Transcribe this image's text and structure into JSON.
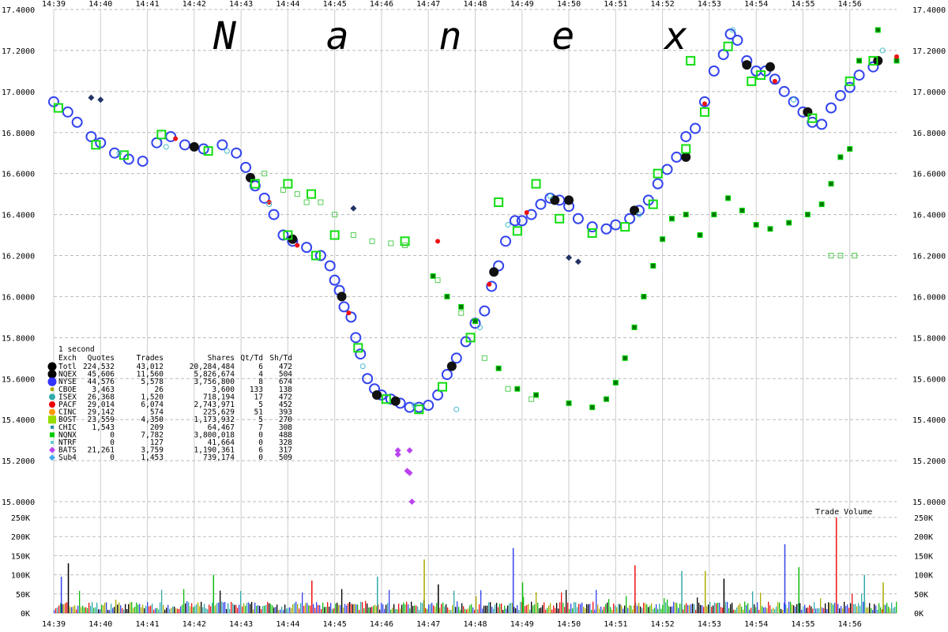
{
  "chart_data": {
    "type": "scatter",
    "watermark": "N a n e x",
    "x_ticks": [
      "14:39",
      "14:40",
      "14:41",
      "14:42",
      "14:43",
      "14:44",
      "14:45",
      "14:46",
      "14:47",
      "14:48",
      "14:49",
      "14:50",
      "14:51",
      "14:52",
      "14:53",
      "14:54",
      "14:55",
      "14:56"
    ],
    "x_range_minutes": [
      0,
      18
    ],
    "y_ticks": [
      "15.0000",
      "15.2000",
      "15.4000",
      "15.6000",
      "15.8000",
      "16.0000",
      "16.2000",
      "16.4000",
      "16.6000",
      "16.8000",
      "17.0000",
      "17.2000",
      "17.4000"
    ],
    "ylim": [
      15.0,
      17.4
    ],
    "volume_ticks": [
      "0K",
      "50K",
      "100K",
      "150K",
      "200K",
      "250K"
    ],
    "volume_ylim": [
      0,
      250000
    ],
    "volume_label": "Trade Volume",
    "grid": true,
    "stats": {
      "interval": "1 second",
      "headers": [
        "Exch",
        "Quotes",
        "Trades",
        "Shares",
        "Qt/Td",
        "Sh/Td"
      ],
      "rows": [
        {
          "exch": "Totl",
          "quotes": "224,532",
          "trades": "43,012",
          "shares": "20,284,484",
          "qt_td": "6",
          "sh_td": "472",
          "color": "#000000",
          "marker": "circle-large"
        },
        {
          "exch": "NQEX",
          "quotes": "45,606",
          "trades": "11,560",
          "shares": "5,826,674",
          "qt_td": "4",
          "sh_td": "504",
          "color": "#000000",
          "marker": "circle-large"
        },
        {
          "exch": "NYSE",
          "quotes": "44,576",
          "trades": "5,578",
          "shares": "3,756,800",
          "qt_td": "8",
          "sh_td": "674",
          "color": "#3333ff",
          "marker": "circle-large"
        },
        {
          "exch": "CBOE",
          "quotes": "3,463",
          "trades": "26",
          "shares": "3,600",
          "qt_td": "133",
          "sh_td": "138",
          "color": "#aaaa00",
          "marker": "circle-small"
        },
        {
          "exch": "ISEX",
          "quotes": "26,368",
          "trades": "1,520",
          "shares": "718,194",
          "qt_td": "17",
          "sh_td": "472",
          "color": "#33aaaa",
          "marker": "circle"
        },
        {
          "exch": "PACF",
          "quotes": "29,014",
          "trades": "6,074",
          "shares": "2,743,971",
          "qt_td": "5",
          "sh_td": "452",
          "color": "#ee0000",
          "marker": "circle"
        },
        {
          "exch": "CINC",
          "quotes": "29,142",
          "trades": "574",
          "shares": "225,629",
          "qt_td": "51",
          "sh_td": "393",
          "color": "#ff9900",
          "marker": "circle"
        },
        {
          "exch": "BOST",
          "quotes": "23,559",
          "trades": "4,350",
          "shares": "1,173,932",
          "qt_td": "5",
          "sh_td": "270",
          "color": "#99dd00",
          "marker": "square-large"
        },
        {
          "exch": "CHIC",
          "quotes": "1,543",
          "trades": "209",
          "shares": "64,467",
          "qt_td": "7",
          "sh_td": "308",
          "color": "#2288aa",
          "marker": "square-small"
        },
        {
          "exch": "NQNX",
          "quotes": "0",
          "trades": "7,782",
          "shares": "3,800,018",
          "qt_td": "0",
          "sh_td": "488",
          "color": "#00cc00",
          "marker": "square"
        },
        {
          "exch": "NTRF",
          "quotes": "0",
          "trades": "127",
          "shares": "41,664",
          "qt_td": "0",
          "sh_td": "328",
          "color": "#66cccc",
          "marker": "square-small"
        },
        {
          "exch": "BATS",
          "quotes": "21,261",
          "trades": "3,759",
          "shares": "1,190,361",
          "qt_td": "6",
          "sh_td": "317",
          "color": "#bb44ee",
          "marker": "diamond"
        },
        {
          "exch": "Sub4",
          "quotes": "0",
          "trades": "1,453",
          "shares": "739,174",
          "qt_td": "0",
          "sh_td": "509",
          "color": "#44aaee",
          "marker": "diamond"
        }
      ]
    },
    "series": [
      {
        "color": "#3344ee",
        "marker": "circle",
        "points": [
          [
            0.0,
            16.95
          ],
          [
            0.3,
            16.9
          ],
          [
            0.5,
            16.85
          ],
          [
            0.8,
            16.78
          ],
          [
            1.0,
            16.75
          ],
          [
            1.3,
            16.7
          ],
          [
            1.6,
            16.67
          ],
          [
            1.9,
            16.66
          ],
          [
            2.2,
            16.75
          ],
          [
            2.5,
            16.78
          ],
          [
            2.8,
            16.74
          ],
          [
            3.2,
            16.72
          ],
          [
            3.6,
            16.74
          ],
          [
            3.9,
            16.7
          ],
          [
            4.1,
            16.63
          ],
          [
            4.3,
            16.54
          ],
          [
            4.5,
            16.48
          ],
          [
            4.7,
            16.4
          ],
          [
            4.9,
            16.3
          ],
          [
            5.1,
            16.27
          ],
          [
            5.4,
            16.24
          ],
          [
            5.7,
            16.2
          ],
          [
            5.9,
            16.15
          ],
          [
            6.0,
            16.08
          ],
          [
            6.1,
            16.03
          ],
          [
            6.2,
            15.95
          ],
          [
            6.35,
            15.9
          ],
          [
            6.45,
            15.8
          ],
          [
            6.55,
            15.72
          ],
          [
            6.7,
            15.6
          ],
          [
            6.85,
            15.55
          ],
          [
            7.0,
            15.52
          ],
          [
            7.2,
            15.5
          ],
          [
            7.4,
            15.48
          ],
          [
            7.6,
            15.46
          ],
          [
            7.8,
            15.46
          ],
          [
            8.0,
            15.47
          ],
          [
            8.2,
            15.52
          ],
          [
            8.4,
            15.62
          ],
          [
            8.6,
            15.7
          ],
          [
            8.8,
            15.78
          ],
          [
            9.0,
            15.87
          ],
          [
            9.2,
            15.93
          ],
          [
            9.35,
            16.05
          ],
          [
            9.5,
            16.15
          ],
          [
            9.65,
            16.27
          ],
          [
            9.85,
            16.37
          ],
          [
            10.0,
            16.37
          ],
          [
            10.2,
            16.4
          ],
          [
            10.4,
            16.45
          ],
          [
            10.6,
            16.48
          ],
          [
            10.8,
            16.47
          ],
          [
            11.0,
            16.44
          ],
          [
            11.2,
            16.38
          ],
          [
            11.5,
            16.34
          ],
          [
            11.8,
            16.33
          ],
          [
            12.0,
            16.35
          ],
          [
            12.3,
            16.38
          ],
          [
            12.5,
            16.42
          ],
          [
            12.7,
            16.47
          ],
          [
            12.9,
            16.55
          ],
          [
            13.1,
            16.62
          ],
          [
            13.3,
            16.68
          ],
          [
            13.5,
            16.78
          ],
          [
            13.7,
            16.82
          ],
          [
            13.9,
            16.95
          ],
          [
            14.1,
            17.1
          ],
          [
            14.3,
            17.18
          ],
          [
            14.45,
            17.28
          ],
          [
            14.6,
            17.25
          ],
          [
            14.8,
            17.15
          ],
          [
            15.0,
            17.1
          ],
          [
            15.2,
            17.1
          ],
          [
            15.4,
            17.06
          ],
          [
            15.6,
            17.0
          ],
          [
            15.8,
            16.95
          ],
          [
            16.0,
            16.9
          ],
          [
            16.2,
            16.85
          ],
          [
            16.4,
            16.84
          ],
          [
            16.6,
            16.92
          ],
          [
            16.8,
            16.98
          ],
          [
            17.0,
            17.02
          ],
          [
            17.2,
            17.08
          ],
          [
            17.5,
            17.12
          ]
        ]
      },
      {
        "color": "#111111",
        "marker": "circle-filled",
        "points": [
          [
            3.0,
            16.73
          ],
          [
            4.2,
            16.58
          ],
          [
            5.1,
            16.28
          ],
          [
            6.15,
            16.0
          ],
          [
            6.9,
            15.52
          ],
          [
            7.3,
            15.49
          ],
          [
            8.5,
            15.66
          ],
          [
            9.4,
            16.12
          ],
          [
            10.7,
            16.47
          ],
          [
            11.0,
            16.47
          ],
          [
            12.4,
            16.42
          ],
          [
            13.5,
            16.68
          ],
          [
            14.8,
            17.13
          ],
          [
            15.3,
            17.12
          ],
          [
            16.1,
            16.9
          ],
          [
            17.6,
            17.15
          ]
        ]
      },
      {
        "color": "#11dd11",
        "marker": "square",
        "points": [
          [
            0.1,
            16.92
          ],
          [
            0.9,
            16.74
          ],
          [
            1.5,
            16.69
          ],
          [
            2.3,
            16.79
          ],
          [
            3.3,
            16.71
          ],
          [
            4.3,
            16.55
          ],
          [
            5.0,
            16.3
          ],
          [
            5.6,
            16.2
          ],
          [
            6.5,
            15.75
          ],
          [
            7.1,
            15.5
          ],
          [
            7.8,
            15.45
          ],
          [
            8.3,
            15.56
          ],
          [
            8.9,
            15.8
          ],
          [
            9.5,
            16.46
          ],
          [
            9.9,
            16.32
          ],
          [
            10.3,
            16.55
          ],
          [
            10.8,
            16.38
          ],
          [
            11.5,
            16.31
          ],
          [
            12.2,
            16.34
          ],
          [
            12.9,
            16.6
          ],
          [
            13.5,
            16.72
          ],
          [
            13.9,
            16.9
          ],
          [
            14.4,
            17.22
          ],
          [
            15.1,
            17.08
          ],
          [
            16.2,
            16.87
          ],
          [
            17.0,
            17.05
          ],
          [
            17.5,
            17.15
          ],
          [
            5.5,
            16.5
          ],
          [
            5.0,
            16.55
          ],
          [
            6.0,
            16.3
          ],
          [
            7.5,
            16.27
          ],
          [
            14.9,
            17.05
          ],
          [
            12.8,
            16.45
          ],
          [
            13.6,
            17.15
          ]
        ]
      },
      {
        "color": "#007700",
        "marker": "square-dark",
        "points": [
          [
            8.1,
            16.1
          ],
          [
            8.4,
            16.0
          ],
          [
            8.7,
            15.95
          ],
          [
            9.0,
            15.88
          ],
          [
            9.5,
            15.65
          ],
          [
            9.9,
            15.55
          ],
          [
            10.3,
            15.52
          ],
          [
            11.0,
            15.48
          ],
          [
            11.5,
            15.46
          ],
          [
            11.8,
            15.5
          ],
          [
            12.0,
            15.58
          ],
          [
            12.2,
            15.7
          ],
          [
            12.4,
            15.85
          ],
          [
            12.6,
            16.0
          ],
          [
            12.8,
            16.15
          ],
          [
            13.0,
            16.28
          ],
          [
            13.2,
            16.38
          ],
          [
            13.5,
            16.4
          ],
          [
            13.8,
            16.3
          ],
          [
            14.1,
            16.4
          ],
          [
            14.4,
            16.48
          ],
          [
            14.7,
            16.42
          ],
          [
            15.0,
            16.35
          ],
          [
            15.3,
            16.33
          ],
          [
            15.7,
            16.36
          ],
          [
            16.1,
            16.4
          ],
          [
            16.4,
            16.45
          ],
          [
            16.6,
            16.55
          ],
          [
            16.8,
            16.68
          ],
          [
            17.0,
            16.72
          ],
          [
            17.2,
            17.15
          ],
          [
            17.6,
            17.3
          ],
          [
            18.0,
            17.15
          ]
        ]
      },
      {
        "color": "#55cc55",
        "marker": "square-open",
        "points": [
          [
            4.5,
            16.6
          ],
          [
            4.9,
            16.52
          ],
          [
            5.2,
            16.5
          ],
          [
            5.4,
            16.46
          ],
          [
            5.7,
            16.46
          ],
          [
            6.0,
            16.4
          ],
          [
            6.4,
            16.3
          ],
          [
            6.8,
            16.27
          ],
          [
            7.2,
            16.26
          ],
          [
            7.5,
            16.25
          ],
          [
            8.2,
            16.08
          ],
          [
            8.7,
            15.92
          ],
          [
            9.2,
            15.7
          ],
          [
            9.7,
            15.55
          ],
          [
            10.2,
            15.5
          ],
          [
            16.6,
            16.2
          ],
          [
            16.8,
            16.2
          ],
          [
            17.1,
            16.2
          ]
        ]
      },
      {
        "color": "#ee1111",
        "marker": "circle-filled-small",
        "points": [
          [
            2.6,
            16.77
          ],
          [
            4.6,
            16.46
          ],
          [
            5.2,
            16.25
          ],
          [
            6.3,
            15.92
          ],
          [
            8.2,
            16.27
          ],
          [
            9.3,
            16.06
          ],
          [
            10.1,
            16.41
          ],
          [
            13.9,
            16.94
          ],
          [
            15.4,
            17.05
          ],
          [
            18.0,
            17.17
          ]
        ]
      },
      {
        "color": "#223366",
        "marker": "diamond",
        "points": [
          [
            0.8,
            16.97
          ],
          [
            1.0,
            16.96
          ],
          [
            6.4,
            16.43
          ],
          [
            11.0,
            16.19
          ],
          [
            11.2,
            16.17
          ]
        ]
      },
      {
        "color": "#bb44ee",
        "marker": "diamond",
        "points": [
          [
            7.35,
            15.25
          ],
          [
            7.6,
            15.25
          ],
          [
            7.55,
            15.15
          ],
          [
            7.6,
            15.14
          ],
          [
            7.65,
            15.0
          ],
          [
            7.35,
            15.23
          ]
        ]
      },
      {
        "color": "#44bbcc",
        "marker": "circle-open-small",
        "points": [
          [
            1.4,
            16.7
          ],
          [
            2.4,
            16.73
          ],
          [
            3.7,
            16.71
          ],
          [
            4.6,
            16.45
          ],
          [
            6.6,
            15.66
          ],
          [
            7.7,
            15.47
          ],
          [
            8.6,
            15.45
          ],
          [
            9.1,
            15.85
          ],
          [
            9.7,
            16.35
          ],
          [
            10.6,
            16.49
          ],
          [
            12.5,
            16.4
          ],
          [
            14.5,
            17.3
          ],
          [
            15.8,
            16.96
          ],
          [
            17.7,
            17.2
          ]
        ]
      }
    ],
    "volume": {
      "seed": 7,
      "spikes": [
        [
          0.3,
          130000
        ],
        [
          0.15,
          95000
        ],
        [
          3.4,
          100000
        ],
        [
          5.5,
          85000
        ],
        [
          6.9,
          95000
        ],
        [
          7.9,
          140000
        ],
        [
          8.2,
          75000
        ],
        [
          9.8,
          170000
        ],
        [
          10.0,
          80000
        ],
        [
          12.4,
          125000
        ],
        [
          13.4,
          110000
        ],
        [
          13.9,
          110000
        ],
        [
          14.3,
          90000
        ],
        [
          15.6,
          180000
        ],
        [
          15.9,
          120000
        ],
        [
          16.7,
          250000
        ],
        [
          17.3,
          100000
        ],
        [
          17.7,
          80000
        ]
      ]
    }
  }
}
